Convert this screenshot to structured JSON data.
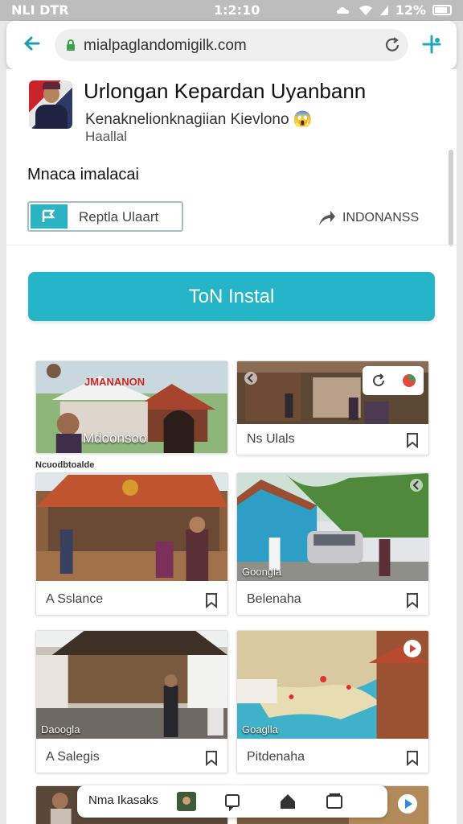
{
  "status_bar": {
    "carrier": "NLI DTR",
    "time": "1:2:10",
    "battery": "12%"
  },
  "browser": {
    "url": "mialpaglandomigilk.com"
  },
  "app": {
    "title": "Urlongan Kepardan Uyanbann",
    "subtitle": "Kenaknelionknagiian Kievlono",
    "subtitle_emoji": "😱",
    "subtitle2": "Haallal",
    "section_label": "Mnaca imalacai",
    "selector_label": "Reptla Ulaart",
    "region_label": "INDONANSS",
    "install_label": "ToN Instal"
  },
  "grid": {
    "heading": "Ncuodbtoalde",
    "cards": [
      {
        "caption": "",
        "overlay": "Mdoonsoo",
        "banner": "JMANANON"
      },
      {
        "caption": "Ns Ulals"
      },
      {
        "caption": "A Sslance"
      },
      {
        "caption": "Belenaha",
        "overlay": "Goongla"
      },
      {
        "caption": "A Salegis",
        "overlay": "Daoogla"
      },
      {
        "caption": "Pitdenaha",
        "overlay": "Goaglla"
      }
    ]
  },
  "dock": {
    "label": "Nma Ikasaks"
  },
  "colors": {
    "accent": "#24b5c8",
    "brand_teal": "#2bb3c4"
  }
}
